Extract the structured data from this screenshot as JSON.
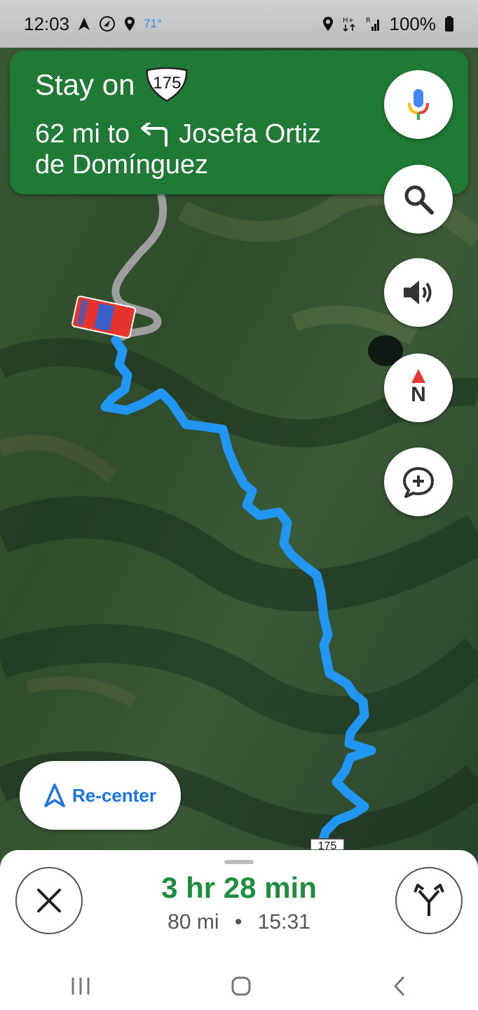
{
  "status_bar": {
    "time": "12:03",
    "temperature": "71°",
    "battery": "100%",
    "icons_left": [
      "navigation-arrow-icon",
      "clock-nav-icon",
      "location-pin-icon"
    ],
    "icons_right": [
      "location-pin-icon",
      "data-arrows-icon",
      "signal-icon",
      "battery-icon"
    ]
  },
  "navigation": {
    "instruction_prefix": "Stay on",
    "route_shield": "175",
    "distance": "62 mi to",
    "turn_icon": "turn-left-icon",
    "destination_line1": "Josefa Ortiz",
    "destination_line2": "de Domínguez",
    "banner_color": "#1f7a36"
  },
  "map": {
    "route_color": "#2196f3",
    "road_shield": "175"
  },
  "controls": {
    "voice": "microphone-icon",
    "search": "search-icon",
    "sound": "speaker-icon",
    "compass_label": "N",
    "report": "add-report-icon",
    "recenter_label": "Re-center"
  },
  "trip": {
    "duration": "3 hr 28 min",
    "distance": "80 mi",
    "separator": "•",
    "arrival": "15:31",
    "eta_color": "#1e8e3e"
  }
}
